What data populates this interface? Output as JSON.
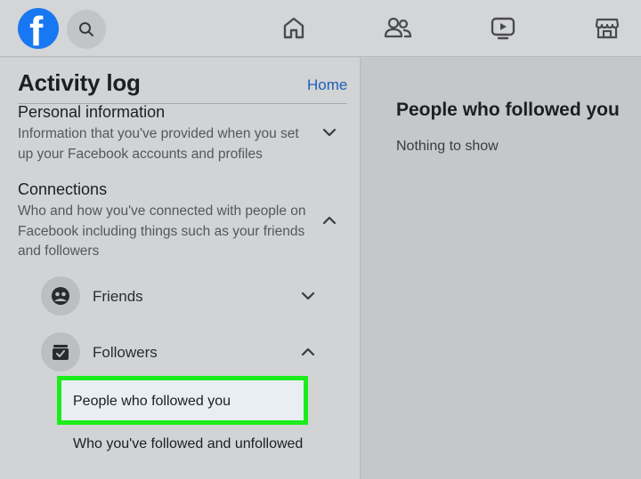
{
  "topbar": {
    "logo": "f",
    "icons": [
      "search-icon",
      "home-icon",
      "friends-icon",
      "watch-icon",
      "marketplace-icon"
    ]
  },
  "left_panel": {
    "title": "Activity log",
    "home_link": "Home",
    "sections": [
      {
        "title": "Personal information",
        "description": "Information that you've provided when you set up your Facebook accounts and profiles",
        "expanded": false
      },
      {
        "title": "Connections",
        "description": "Who and how you've connected with people on Facebook including things such as your friends and followers",
        "expanded": true
      }
    ],
    "subsections": [
      {
        "label": "Friends",
        "icon": "friends-face-icon",
        "expanded": false
      },
      {
        "label": "Followers",
        "icon": "followers-icon",
        "expanded": true
      }
    ],
    "items": [
      {
        "label": "People who followed you",
        "highlighted": true
      },
      {
        "label": "Who you've followed and unfollowed",
        "highlighted": false
      }
    ]
  },
  "right_panel": {
    "title": "People who followed you",
    "empty_text": "Nothing to show"
  },
  "colors": {
    "brand": "#1877f2",
    "link": "#1c5fb8",
    "highlight_border": "#1aed1a"
  }
}
